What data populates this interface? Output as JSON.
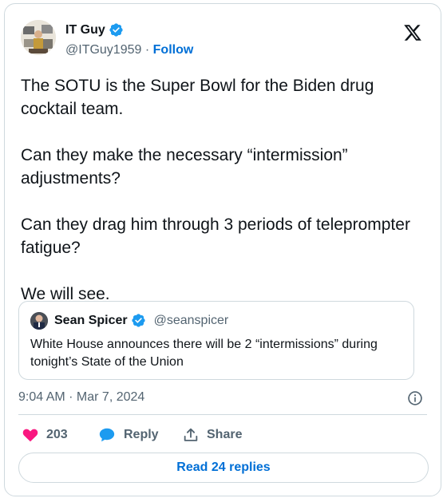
{
  "author": {
    "name": "IT Guy",
    "handle": "@ITGuy1959",
    "separator": "·",
    "follow_label": "Follow"
  },
  "tweet": {
    "paragraphs": [
      "The SOTU is the Super Bowl for the Biden drug cocktail team.",
      "Can they make the necessary “intermission” adjustments?",
      "Can they drag him through 3 periods of teleprompter fatigue?",
      "We will see."
    ],
    "timestamp": "9:04 AM · Mar 7, 2024"
  },
  "quote": {
    "name": "Sean Spicer",
    "handle": "@seanspicer",
    "text": "White House announces there will be 2 “intermissions” during tonight’s State of the Union"
  },
  "actions": {
    "like_count": "203",
    "reply_label": "Reply",
    "share_label": "Share",
    "read_replies_label": "Read 24 replies"
  },
  "colors": {
    "link": "#006fd6",
    "verified": "#1d9bf0",
    "like": "#f91880",
    "reply_bubble": "#1d9bf0",
    "secondary_text": "#536471",
    "border": "#cfd9de"
  },
  "icons": {
    "x_logo": "x-logo-icon",
    "verified": "verified-badge-icon",
    "info": "info-icon",
    "like": "heart-icon",
    "reply": "reply-bubble-icon",
    "share": "share-upload-icon"
  }
}
